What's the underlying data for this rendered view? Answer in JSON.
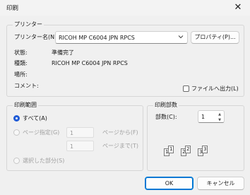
{
  "window": {
    "title": "印刷",
    "close_glyph": "✕"
  },
  "printer": {
    "group_label": "プリンター",
    "name_label": "プリンター名(N):",
    "name_value": "RICOH MP C6004 JPN RPCS",
    "properties_label": "プロパティ(P)...",
    "status_label": "状態:",
    "status_value": "準備完了",
    "type_label": "種類:",
    "type_value": "RICOH MP C6004 JPN RPCS",
    "where_label": "場所:",
    "where_value": "",
    "comment_label": "コメント:",
    "comment_value": "",
    "print_to_file_label": "ファイルへ出力(L)",
    "print_to_file_checked": false
  },
  "range": {
    "group_label": "印刷範囲",
    "all_label": "すべて(A)",
    "pages_label": "ページ指定(G)",
    "from_value": "1",
    "from_label": "ページから(F)",
    "to_value": "1",
    "to_label": "ページまで(T)",
    "selection_label": "選択した部分(S)",
    "selected": "all"
  },
  "copies": {
    "group_label": "印刷部数",
    "count_label": "部数(C):",
    "count_value": "1",
    "collate_pages": [
      "1",
      "1",
      "2",
      "2",
      "3",
      "3"
    ]
  },
  "buttons": {
    "ok_label": "OK",
    "cancel_label": "キャンセル"
  },
  "colors": {
    "accent": "#0078d4",
    "radio_selected": "#1f5bd6"
  },
  "icons": [
    "close-icon",
    "chevron-down-icon",
    "spin-up-icon",
    "spin-down-icon",
    "collate-pages-icon"
  ]
}
